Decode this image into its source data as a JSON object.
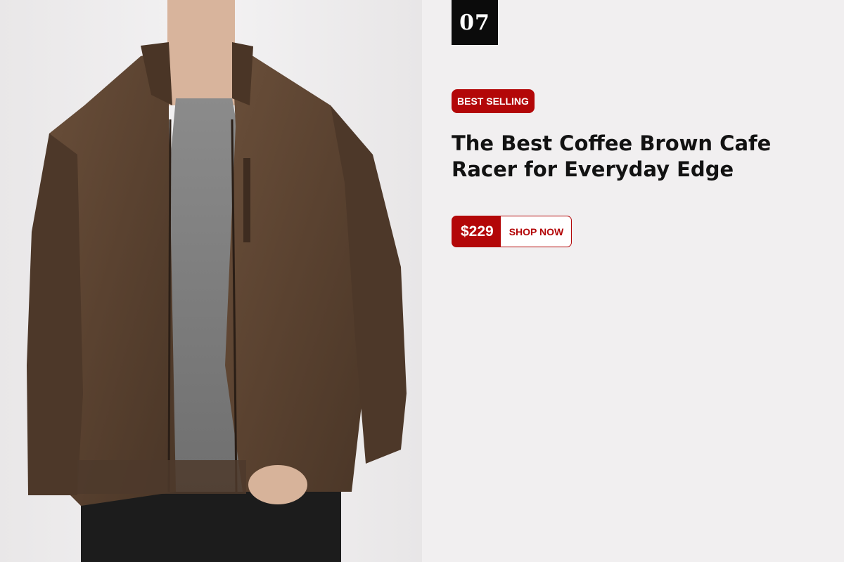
{
  "hero": {
    "image_alt": "man-wearing-coffee-brown-suede-cafe-racer-jacket"
  },
  "product": {
    "number": "07",
    "badge": "BEST SELLING",
    "title": "The Best Coffee Brown Cafe Racer for Everyday Edge",
    "price": "$229",
    "cta_label": "SHOP NOW"
  },
  "colors": {
    "accent_red": "#b30708",
    "number_box_bg": "#0b0b0b",
    "panel_bg": "#f1eff0",
    "jacket_brown": "#5b4330"
  }
}
